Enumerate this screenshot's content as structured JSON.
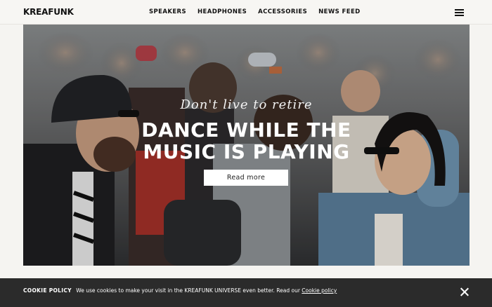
{
  "brand": {
    "logo_text": "KREAFUNK"
  },
  "nav": {
    "items": [
      {
        "label": "SPEAKERS"
      },
      {
        "label": "HEADPHONES"
      },
      {
        "label": "ACCESSORIES"
      },
      {
        "label": "NEWS FEED"
      }
    ],
    "menu_icon": "hamburger-menu-icon"
  },
  "hero": {
    "script_text": "Don't live to retire",
    "title_line1": "DANCE WHILE THE",
    "title_line2": "MUSIC IS PLAYING",
    "button_label": "Read more"
  },
  "cookie": {
    "title": "COOKIE POLICY",
    "message": "We use cookies to make your visit in the KREAFUNK UNIVERSE even better. Read our",
    "link_label": "Cookie policy",
    "close_icon": "close-icon"
  },
  "colors": {
    "background": "#f5f4f1",
    "cookie_bar": "#2b2b2b",
    "text": "#111111"
  }
}
